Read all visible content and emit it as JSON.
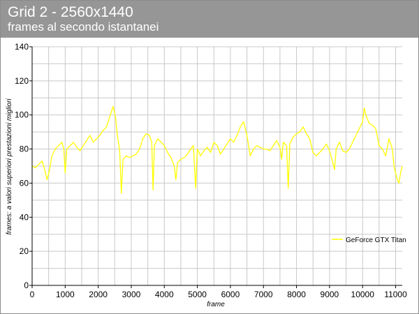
{
  "header": {
    "title": "Grid 2 - 2560x1440",
    "subtitle": "frames al secondo istantanei"
  },
  "chart_data": {
    "type": "line",
    "title": "Grid 2 - 2560x1440",
    "subtitle": "frames al secondo istantanei",
    "xlabel": "frame",
    "ylabel": "frames: a valori superiori prestazioni migliori",
    "xlim": [
      0,
      11200
    ],
    "ylim": [
      0,
      140
    ],
    "x_ticks": [
      0,
      1000,
      2000,
      3000,
      4000,
      5000,
      6000,
      7000,
      8000,
      9000,
      10000,
      11000
    ],
    "y_ticks": [
      0,
      20,
      40,
      60,
      80,
      100,
      120,
      140
    ],
    "grid": true,
    "legend_position": "lower-right",
    "series": [
      {
        "name": "GeForce GTX Titan",
        "color": "#ffff00",
        "points": [
          [
            0,
            70
          ],
          [
            100,
            69
          ],
          [
            200,
            71
          ],
          [
            300,
            73
          ],
          [
            380,
            68
          ],
          [
            450,
            62
          ],
          [
            520,
            67
          ],
          [
            600,
            76
          ],
          [
            700,
            80
          ],
          [
            800,
            82
          ],
          [
            900,
            84
          ],
          [
            960,
            80
          ],
          [
            1000,
            66
          ],
          [
            1050,
            80
          ],
          [
            1150,
            82
          ],
          [
            1250,
            84
          ],
          [
            1350,
            81
          ],
          [
            1450,
            79
          ],
          [
            1550,
            82
          ],
          [
            1650,
            85
          ],
          [
            1750,
            88
          ],
          [
            1850,
            84
          ],
          [
            1950,
            86
          ],
          [
            2050,
            88
          ],
          [
            2150,
            91
          ],
          [
            2250,
            93
          ],
          [
            2350,
            99
          ],
          [
            2450,
            105
          ],
          [
            2520,
            99
          ],
          [
            2580,
            88
          ],
          [
            2650,
            79
          ],
          [
            2700,
            54
          ],
          [
            2750,
            74
          ],
          [
            2850,
            76
          ],
          [
            2950,
            75
          ],
          [
            3050,
            76
          ],
          [
            3150,
            77
          ],
          [
            3250,
            80
          ],
          [
            3350,
            86
          ],
          [
            3450,
            89
          ],
          [
            3550,
            88
          ],
          [
            3620,
            84
          ],
          [
            3660,
            56
          ],
          [
            3700,
            82
          ],
          [
            3800,
            86
          ],
          [
            3900,
            84
          ],
          [
            4000,
            82
          ],
          [
            4100,
            78
          ],
          [
            4200,
            75
          ],
          [
            4300,
            70
          ],
          [
            4350,
            62
          ],
          [
            4400,
            72
          ],
          [
            4500,
            74
          ],
          [
            4600,
            75
          ],
          [
            4700,
            77
          ],
          [
            4800,
            80
          ],
          [
            4880,
            82
          ],
          [
            4950,
            57
          ],
          [
            5000,
            80
          ],
          [
            5100,
            76
          ],
          [
            5200,
            79
          ],
          [
            5300,
            81
          ],
          [
            5400,
            78
          ],
          [
            5500,
            84
          ],
          [
            5600,
            82
          ],
          [
            5700,
            77
          ],
          [
            5800,
            80
          ],
          [
            5900,
            83
          ],
          [
            6000,
            86
          ],
          [
            6100,
            84
          ],
          [
            6200,
            88
          ],
          [
            6300,
            93
          ],
          [
            6400,
            96
          ],
          [
            6500,
            88
          ],
          [
            6600,
            76
          ],
          [
            6700,
            80
          ],
          [
            6800,
            82
          ],
          [
            6900,
            81
          ],
          [
            7000,
            80
          ],
          [
            7100,
            80
          ],
          [
            7200,
            79
          ],
          [
            7300,
            82
          ],
          [
            7400,
            85
          ],
          [
            7500,
            81
          ],
          [
            7550,
            74
          ],
          [
            7600,
            84
          ],
          [
            7700,
            82
          ],
          [
            7750,
            57
          ],
          [
            7800,
            83
          ],
          [
            7900,
            87
          ],
          [
            8000,
            89
          ],
          [
            8100,
            90
          ],
          [
            8200,
            93
          ],
          [
            8300,
            89
          ],
          [
            8400,
            86
          ],
          [
            8500,
            78
          ],
          [
            8600,
            76
          ],
          [
            8700,
            78
          ],
          [
            8800,
            80
          ],
          [
            8900,
            83
          ],
          [
            9000,
            79
          ],
          [
            9100,
            72
          ],
          [
            9150,
            68
          ],
          [
            9200,
            80
          ],
          [
            9300,
            84
          ],
          [
            9400,
            79
          ],
          [
            9500,
            78
          ],
          [
            9600,
            80
          ],
          [
            9700,
            84
          ],
          [
            9800,
            88
          ],
          [
            9900,
            92
          ],
          [
            10000,
            96
          ],
          [
            10050,
            104
          ],
          [
            10100,
            100
          ],
          [
            10200,
            95
          ],
          [
            10300,
            94
          ],
          [
            10400,
            92
          ],
          [
            10500,
            82
          ],
          [
            10600,
            80
          ],
          [
            10700,
            76
          ],
          [
            10800,
            86
          ],
          [
            10900,
            80
          ],
          [
            10950,
            70
          ],
          [
            11000,
            66
          ],
          [
            11050,
            62
          ],
          [
            11100,
            60
          ],
          [
            11150,
            66
          ],
          [
            11200,
            70
          ]
        ]
      }
    ]
  }
}
